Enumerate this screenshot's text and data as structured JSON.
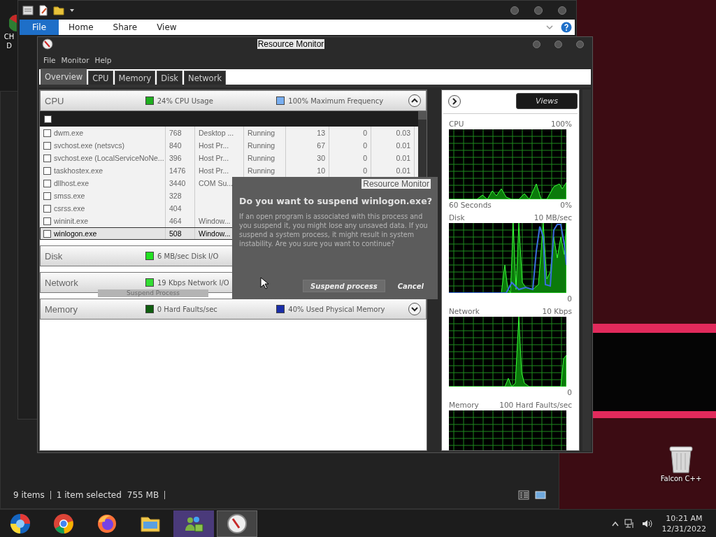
{
  "desktop_icons": [
    {
      "kind": "app",
      "lines": [
        "CH",
        "D"
      ]
    },
    {
      "kind": "recycle-bin",
      "lines": [
        "Falcon C++"
      ]
    }
  ],
  "explorer_back": {
    "status_bar": {
      "count": "9 items",
      "selection": "1 item selected",
      "size": "755 MB"
    }
  },
  "explorer": {
    "ribbon_tabs": [
      {
        "label": "File",
        "selected": true
      },
      {
        "label": "Home",
        "selected": false
      },
      {
        "label": "Share",
        "selected": false
      },
      {
        "label": "View",
        "selected": false
      }
    ]
  },
  "resource_monitor": {
    "title": "Resource Monitor",
    "menu": [
      "File",
      "Monitor",
      "Help"
    ],
    "tabs": [
      {
        "label": "Overview",
        "selected": true
      },
      {
        "label": "CPU",
        "selected": false
      },
      {
        "label": "Memory",
        "selected": false
      },
      {
        "label": "Disk",
        "selected": false
      },
      {
        "label": "Network",
        "selected": false
      }
    ],
    "sections": [
      {
        "name": "CPU",
        "expanded": true,
        "metrics": [
          {
            "text": "24% CPU Usage",
            "color": "#1fae1f"
          },
          {
            "text": "100% Maximum Frequency",
            "color": "#78aef0"
          }
        ],
        "all_checked": false,
        "rows": [
          {
            "checked": false,
            "selected": false,
            "name": "dwm.exe",
            "pid": "768",
            "description": "Desktop ...",
            "status": "Running",
            "threads": "13",
            "cpu": "0",
            "avg_cpu": "0.03"
          },
          {
            "checked": false,
            "selected": false,
            "name": "svchost.exe (netsvcs)",
            "pid": "840",
            "description": "Host Pr...",
            "status": "Running",
            "threads": "67",
            "cpu": "0",
            "avg_cpu": "0.01"
          },
          {
            "checked": false,
            "selected": false,
            "name": "svchost.exe (LocalServiceNoNe...",
            "pid": "396",
            "description": "Host Pr...",
            "status": "Running",
            "threads": "30",
            "cpu": "0",
            "avg_cpu": "0.01"
          },
          {
            "checked": false,
            "selected": false,
            "name": "taskhostex.exe",
            "pid": "1476",
            "description": "Host Pr...",
            "status": "Running",
            "threads": "10",
            "cpu": "0",
            "avg_cpu": "0.01"
          },
          {
            "checked": false,
            "selected": false,
            "name": "dllhost.exe",
            "pid": "3440",
            "description": "COM Su..."
          },
          {
            "checked": false,
            "selected": false,
            "name": "smss.exe",
            "pid": "328"
          },
          {
            "checked": false,
            "selected": false,
            "name": "csrss.exe",
            "pid": "404"
          },
          {
            "checked": false,
            "selected": false,
            "name": "wininit.exe",
            "pid": "464",
            "description": "Window..."
          },
          {
            "checked": false,
            "selected": true,
            "name": "winlogon.exe",
            "pid": "508",
            "description": "Window..."
          }
        ]
      },
      {
        "name": "Disk",
        "metrics": [
          {
            "text": "6 MB/sec Disk I/O",
            "color": "#22e022"
          }
        ]
      },
      {
        "name": "Network",
        "metrics": [
          {
            "text": "19 Kbps Network I/O",
            "color": "#33dd33"
          }
        ]
      },
      {
        "name": "Memory",
        "expanded": false,
        "metrics": [
          {
            "text": "0 Hard Faults/sec",
            "color": "#0f5e0f"
          },
          {
            "text": "40% Used Physical Memory",
            "color": "#1a2ea8"
          }
        ]
      }
    ],
    "views_button": "Views",
    "graphs": [
      {
        "kind": "cpu",
        "title": "CPU",
        "max": "100%",
        "span": "60 Seconds",
        "min": "0%"
      },
      {
        "kind": "disk",
        "title": "Disk",
        "max": "10 MB/sec",
        "min": "0"
      },
      {
        "kind": "network",
        "title": "Network",
        "max": "10 Kbps",
        "min": "0"
      },
      {
        "kind": "memory",
        "title": "Memory",
        "max": "100 Hard Faults/sec"
      }
    ]
  },
  "ghost_button": "Suspend Process",
  "dialog": {
    "title": "Resource Monitor",
    "heading": "Do you want to suspend winlogon.exe?",
    "body": "If an open program is associated with this process and you suspend it, you might lose any unsaved data. If you suspend a system process, it might result in system instability. Are you sure you want to continue?",
    "buttons": [
      {
        "label": "Suspend process",
        "kind": "primary"
      },
      {
        "label": "Cancel",
        "kind": "secondary"
      }
    ]
  },
  "taskbar": {
    "apps": [
      {
        "kind": "orb",
        "selected": false
      },
      {
        "kind": "chrome",
        "selected": false
      },
      {
        "kind": "firefox",
        "selected": false
      },
      {
        "kind": "folder",
        "selected": false
      },
      {
        "kind": "messenger",
        "selected": false
      },
      {
        "kind": "gauge",
        "selected": true
      }
    ],
    "clock": {
      "time": "10:21 AM",
      "date": "12/31/2022"
    }
  }
}
